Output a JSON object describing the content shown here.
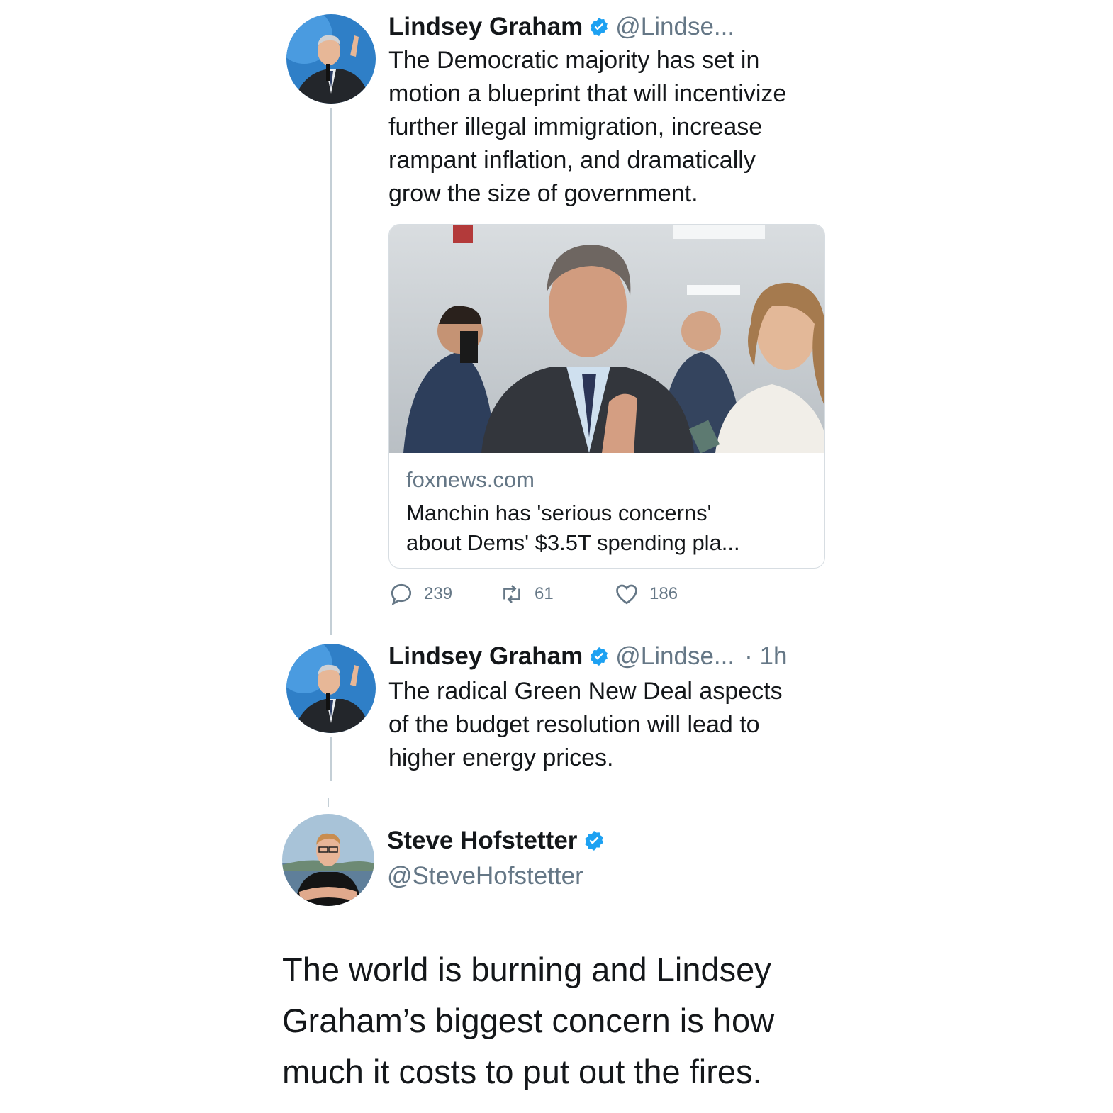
{
  "tweets": [
    {
      "name": "Lindsey Graham",
      "handle": "@Lindse...",
      "time": "",
      "avatar_icon": "lindsey-graham-avatar",
      "text_lines": [
        "The Democratic majority has set in",
        "motion a blueprint that will incentivize",
        "further illegal immigration, increase",
        "rampant inflation, and dramatically",
        "grow the size of government."
      ],
      "card": {
        "image_icon": "news-photo-manchin",
        "domain": "foxnews.com",
        "title_lines": [
          "Manchin has 'serious concerns'",
          "about Dems' $3.5T spending pla..."
        ]
      },
      "actions": {
        "replies": "239",
        "retweets": "61",
        "likes": "186"
      }
    },
    {
      "name": "Lindsey Graham",
      "handle": "@Lindse...",
      "time": "· 1h",
      "avatar_icon": "lindsey-graham-avatar",
      "text_lines": [
        "The radical Green New Deal aspects",
        "of the budget resolution will lead to",
        "higher energy prices."
      ]
    }
  ],
  "quote": {
    "name": "Steve Hofstetter",
    "handle": "@SteveHofstetter",
    "avatar_icon": "steve-hofstetter-avatar",
    "text_lines": [
      "The world is burning and Lindsey",
      "Graham’s biggest concern is how",
      "much it costs to put out the fires."
    ]
  },
  "colors": {
    "verified_blue": "#1da1f2",
    "secondary_text": "#657786",
    "thread_line": "#c4cfd6"
  }
}
